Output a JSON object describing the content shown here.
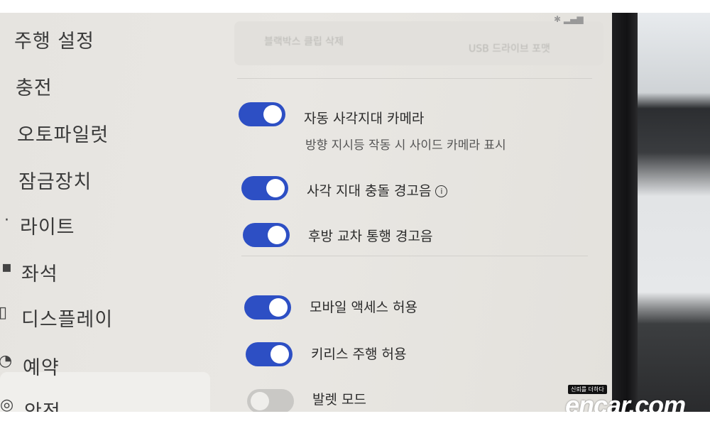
{
  "sidebar": {
    "items": [
      {
        "label": "주행 설정",
        "icon": ""
      },
      {
        "label": "충전",
        "icon": ""
      },
      {
        "label": "오토파일럿",
        "icon": ""
      },
      {
        "label": "잠금장치",
        "icon": ""
      },
      {
        "label": "라이트",
        "icon": "light-icon"
      },
      {
        "label": "좌석",
        "icon": "seat-icon"
      },
      {
        "label": "디스플레이",
        "icon": "display-icon"
      },
      {
        "label": "예약",
        "icon": "schedule-icon"
      },
      {
        "label": "안전",
        "icon": "safety-icon",
        "active": true
      }
    ]
  },
  "top": {
    "faded_left": "블랙박스 클립 삭제",
    "faded_right": "USB 드라이브 포맷"
  },
  "settings": {
    "blind_spot_camera": {
      "label": "자동 사각지대 카메라",
      "sub": "방향 지시등 작동 시 사이드 카메라 표시",
      "on": true
    },
    "blind_spot_warning": {
      "label": "사각 지대 충돌 경고음",
      "on": true,
      "info_glyph": "i"
    },
    "rear_cross_traffic": {
      "label": "후방 교차 통행 경고음",
      "on": true
    },
    "mobile_access": {
      "label": "모바일 액세스 허용",
      "on": true
    },
    "keyless_driving": {
      "label": "키리스 주행 허용",
      "on": true
    },
    "valet_mode": {
      "label": "발렛 모드",
      "on": false
    }
  },
  "watermark": {
    "tag": "신뢰를 더하다",
    "logo": "encar.com"
  },
  "colors": {
    "toggle_on": "#2d4fc4",
    "toggle_off": "#c9c8c5",
    "screen_bg": "#e6e4e0"
  }
}
